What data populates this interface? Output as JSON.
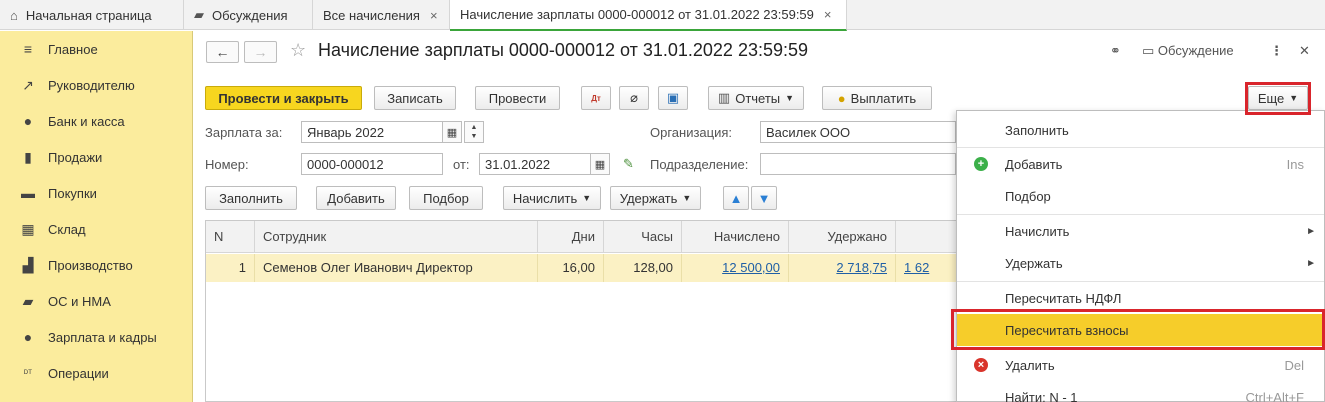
{
  "tabs": [
    {
      "label": "Начальная страница",
      "icon": "home-icon"
    },
    {
      "label": "Обсуждения",
      "icon": "chat-icon"
    },
    {
      "label": "Все начисления",
      "close": "×"
    },
    {
      "label": "Начисление зарплаты 0000-000012 от 31.01.2022 23:59:59",
      "close": "×",
      "active": true
    }
  ],
  "sidebar": {
    "items": [
      {
        "label": "Главное",
        "icon": "menu-icon"
      },
      {
        "label": "Руководителю",
        "icon": "trend-icon"
      },
      {
        "label": "Банк и касса",
        "icon": "ruble-coin-icon"
      },
      {
        "label": "Продажи",
        "icon": "shopping-bag-icon"
      },
      {
        "label": "Покупки",
        "icon": "cart-icon"
      },
      {
        "label": "Склад",
        "icon": "warehouse-icon"
      },
      {
        "label": "Производство",
        "icon": "factory-icon"
      },
      {
        "label": "ОС и НМА",
        "icon": "truck-icon"
      },
      {
        "label": "Зарплата и кадры",
        "icon": "person-icon"
      },
      {
        "label": "Операции",
        "icon": "dt-kt-icon"
      }
    ]
  },
  "document": {
    "title": "Начисление зарплаты 0000-000012 от 31.01.2022 23:59:59",
    "discussion_label": "Обсуждение",
    "toolbar": {
      "post_close": "Провести и закрыть",
      "save": "Записать",
      "post": "Провести",
      "reports": "Отчеты",
      "pay": "Выплатить",
      "more": "Еще"
    },
    "form": {
      "salary_for_label": "Зарплата за:",
      "salary_for_value": "Январь 2022",
      "org_label": "Организация:",
      "org_value": "Василек ООО",
      "number_label": "Номер:",
      "number_value": "0000-000012",
      "from_label": "от:",
      "date_value": "31.01.2022",
      "division_label": "Подразделение:",
      "division_value": ""
    },
    "table_toolbar": {
      "fill": "Заполнить",
      "add": "Добавить",
      "select": "Подбор",
      "accrue": "Начислить",
      "withhold": "Удержать"
    },
    "table": {
      "columns": [
        "N",
        "Сотрудник",
        "Дни",
        "Часы",
        "Начислено",
        "Удержано"
      ],
      "rows": [
        {
          "n": "1",
          "employee": "Семенов Олег Иванович Директор",
          "days": "16,00",
          "hours": "128,00",
          "accrued": "12 500,00",
          "withheld": "2 718,75",
          "extra": "1 62"
        }
      ]
    }
  },
  "more_menu": {
    "items": [
      {
        "label": "Заполнить",
        "shortcut": ""
      },
      {
        "label": "Добавить",
        "shortcut": "Ins",
        "icon": "plus-icon"
      },
      {
        "label": "Подбор",
        "shortcut": ""
      },
      {
        "label": "Начислить",
        "submenu": "►"
      },
      {
        "label": "Удержать",
        "submenu": "►"
      },
      {
        "label": "Пересчитать НДФЛ",
        "shortcut": ""
      },
      {
        "label": "Пересчитать взносы",
        "shortcut": "",
        "highlighted": true
      },
      {
        "label": "Удалить",
        "shortcut": "Del",
        "icon": "delete-icon"
      },
      {
        "label": "Найти: N - 1",
        "shortcut": "Ctrl+Alt+F"
      }
    ]
  },
  "colors": {
    "sidebar_bg": "#fbec9d",
    "primary_button": "#f7d61f",
    "highlight": "#f6cd2a",
    "annotation_red": "#d9252c",
    "link": "#1f5fa6"
  }
}
